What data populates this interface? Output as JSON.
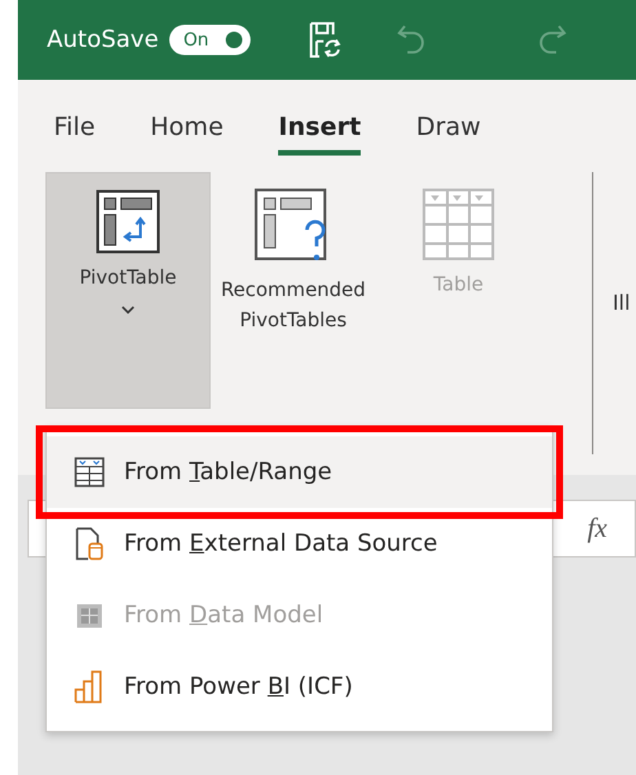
{
  "title_bar": {
    "autosave_label": "AutoSave",
    "autosave": {
      "label": "On",
      "on": true
    }
  },
  "tabs": [
    {
      "label": "File",
      "selected": false
    },
    {
      "label": "Home",
      "selected": false
    },
    {
      "label": "Insert",
      "selected": true
    },
    {
      "label": "Draw",
      "selected": false
    }
  ],
  "ribbon": {
    "buttons": [
      {
        "kind": "pivot",
        "lines": [
          "PivotTable"
        ],
        "pressed": true,
        "dropdown": true,
        "disabled": false
      },
      {
        "kind": "recommended",
        "lines": [
          "Recommended",
          "PivotTables"
        ],
        "pressed": false,
        "dropdown": false,
        "disabled": false
      },
      {
        "kind": "table",
        "lines": [
          "Table"
        ],
        "pressed": false,
        "dropdown": false,
        "disabled": true
      }
    ],
    "cut_group_label": "Ill"
  },
  "formula_bar": {
    "function_label": "fx"
  },
  "menu": {
    "items": [
      {
        "kind": "table-range",
        "before": "From ",
        "access_key": "T",
        "after": "able/Range",
        "disabled": false,
        "highlighted": true
      },
      {
        "kind": "external",
        "before": "From ",
        "access_key": "E",
        "after": "xternal Data Source",
        "disabled": false,
        "highlighted": false
      },
      {
        "kind": "data-model",
        "before": "From ",
        "access_key": "D",
        "after": "ata Model",
        "disabled": true,
        "highlighted": false
      },
      {
        "kind": "power-bi",
        "before": "From Power ",
        "access_key": "B",
        "after": "I (ICF)",
        "disabled": false,
        "highlighted": false
      }
    ]
  }
}
